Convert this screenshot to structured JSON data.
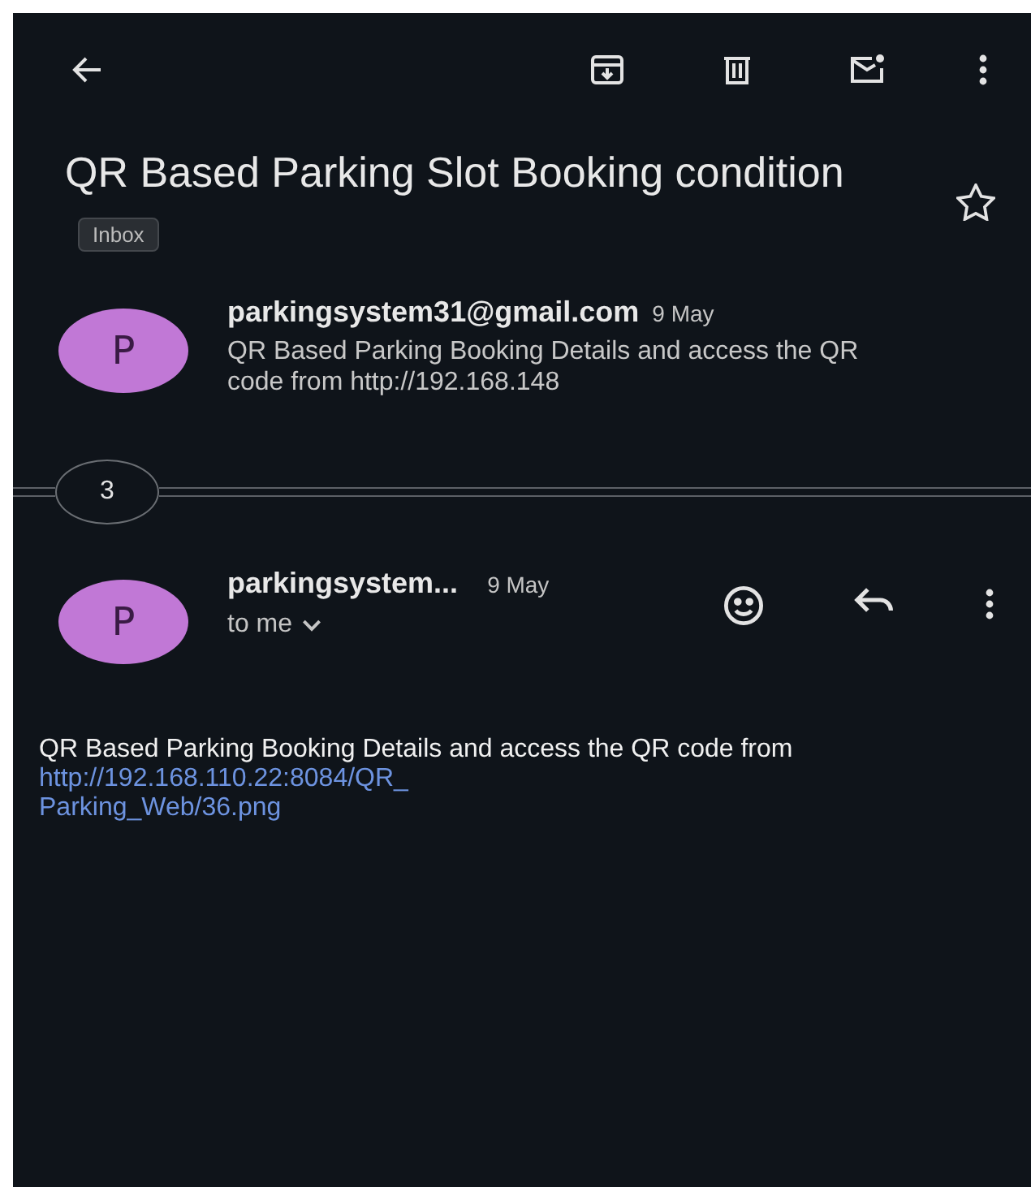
{
  "subject": {
    "title": "QR Based Parking Slot Booking condition",
    "label": "Inbox",
    "starred": false
  },
  "collapsed_message": {
    "avatar": "P",
    "sender": "parkingsystem31@gmail.com",
    "date": "9 May",
    "snippet": "QR Based Parking Booking Details and access the QR code from http://192.168.148"
  },
  "hidden_count": "3",
  "open_message": {
    "avatar": "P",
    "sender": "parkingsystem...",
    "date": "9 May",
    "recipient": "to me",
    "body": {
      "text": "QR Based Parking Booking Details and access the QR code from",
      "link_lines": [
        "http://192.168.110.22:8084/QR_",
        "Parking_Web/36.png"
      ]
    }
  }
}
